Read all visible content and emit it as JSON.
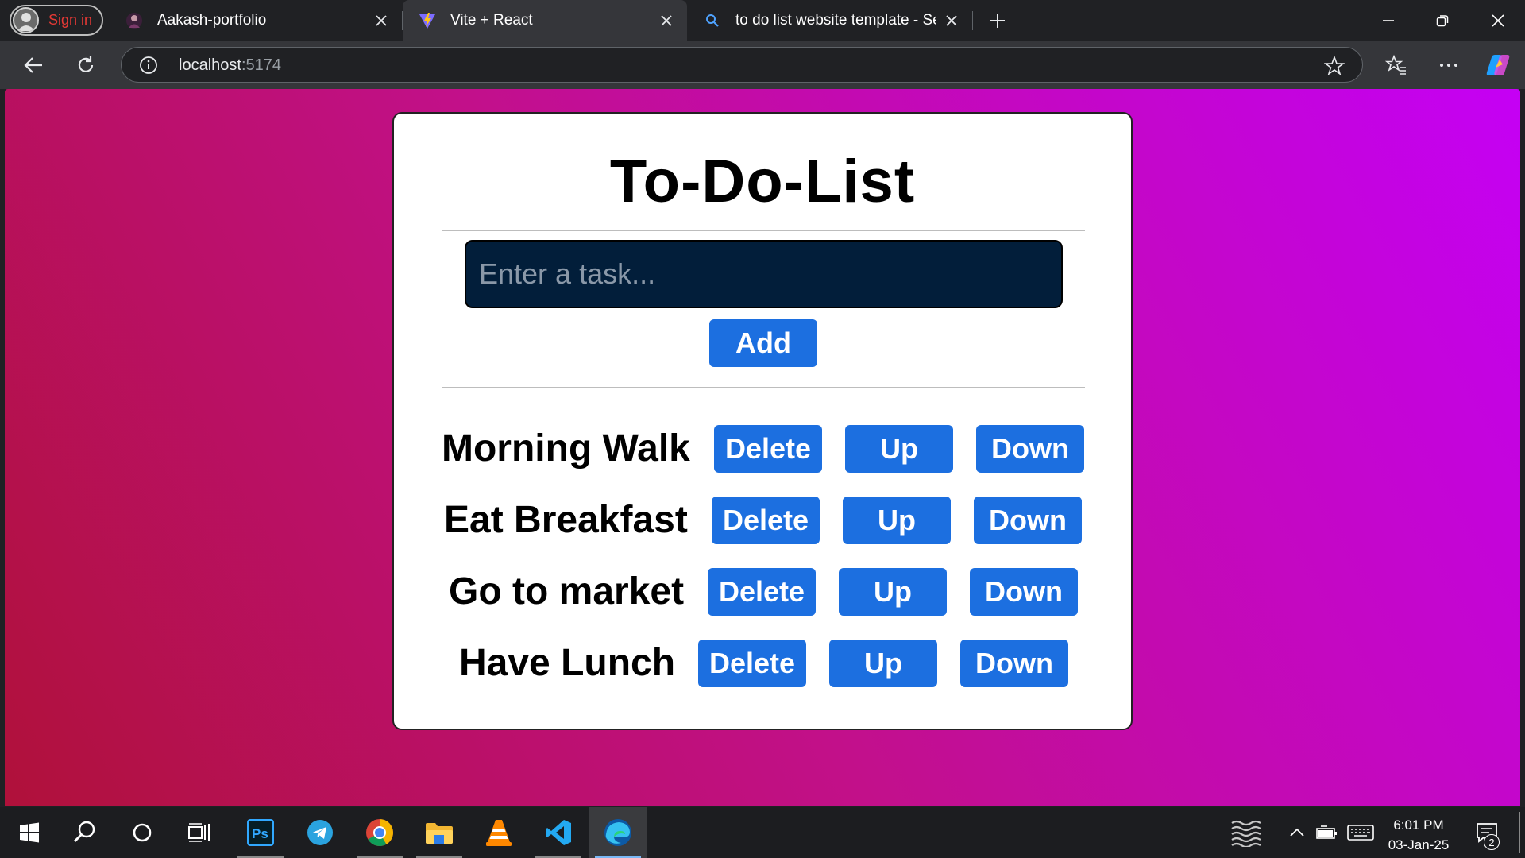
{
  "browser": {
    "profile": {
      "signin_label": "Sign in"
    },
    "tabs": [
      {
        "title": "Aakash-portfolio",
        "icon": "portfolio-favicon"
      },
      {
        "title": "Vite + React",
        "icon": "vite-favicon",
        "active": true
      },
      {
        "title": "to do list website template - Search",
        "icon": "search-favicon"
      }
    ],
    "address": {
      "host": "localhost",
      "port": ":5174"
    }
  },
  "app": {
    "heading": "To-Do-List",
    "input": {
      "placeholder": "Enter a task...",
      "value": ""
    },
    "add_label": "Add",
    "delete_label": "Delete",
    "up_label": "Up",
    "down_label": "Down",
    "tasks": [
      "Morning Walk",
      "Eat Breakfast",
      "Go to market",
      "Have Lunch"
    ]
  },
  "taskbar": {
    "apps": [
      "start-icon",
      "search-icon",
      "cortana-icon",
      "task-view-icon",
      "photoshop-icon",
      "telegram-icon",
      "chrome-icon",
      "file-explorer-icon",
      "vlc-icon",
      "vscode-icon",
      "edge-icon"
    ],
    "time": "6:01 PM",
    "date": "03-Jan-25",
    "notification_count": "2"
  },
  "colors": {
    "accent_button": "#1c6fe0",
    "input_bg": "#021e3a",
    "gradient_start": "#b0113a",
    "gradient_end": "#c500f5"
  }
}
